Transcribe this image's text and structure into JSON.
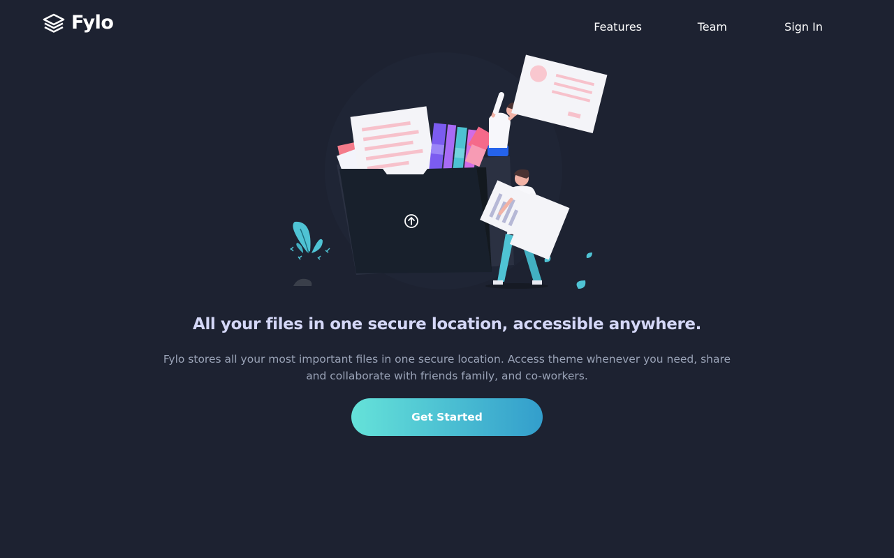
{
  "brand": {
    "name": "Fylo",
    "logo_icon": "stacked-layers-icon"
  },
  "nav": {
    "items": [
      {
        "label": "Features"
      },
      {
        "label": "Team"
      },
      {
        "label": "Sign In"
      }
    ]
  },
  "hero": {
    "illustration": "people-organizing-files-illustration",
    "upload_icon": "upload-arrow-icon",
    "headline": "All your files in one secure location, accessible anywhere.",
    "description": "Fylo stores all your most important files in one secure location. Access theme whenever you need, share and collaborate with friends family, and co-workers.",
    "cta_label": "Get Started"
  },
  "colors": {
    "background": "#1d2231",
    "headline": "#d4d7f7",
    "body_text": "#9aa3b7",
    "cta_gradient_start": "#65e2d9",
    "cta_gradient_end": "#339ecc"
  }
}
